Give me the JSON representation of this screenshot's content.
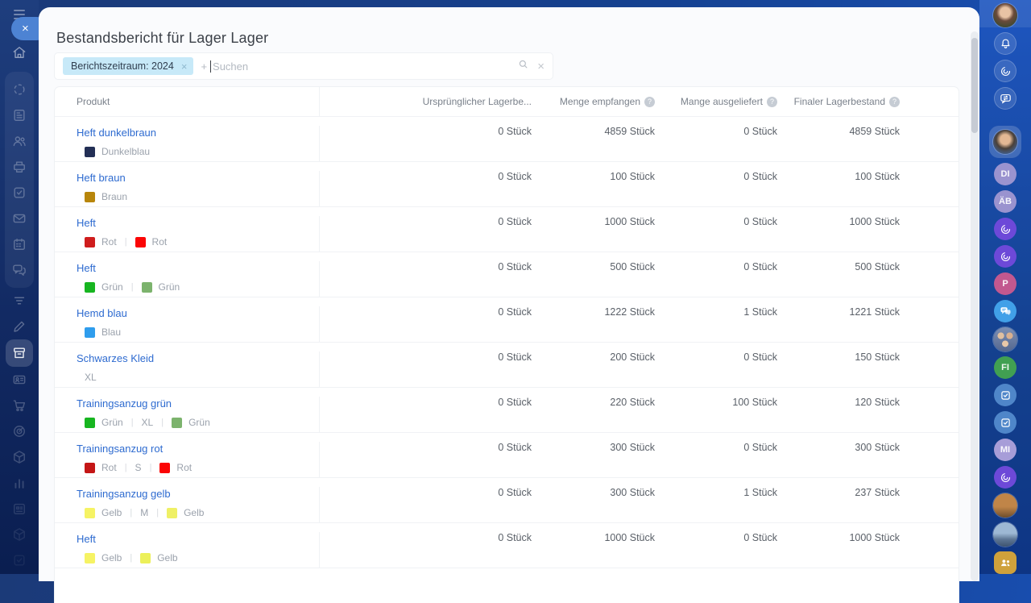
{
  "title": "Bestandsbericht für Lager Lager",
  "filters": {
    "tag_label": "Berichtszeitraum: 2024",
    "remove_glyph": "×",
    "plus_glyph": "+",
    "search_placeholder": "Suchen",
    "clear_glyph": "×"
  },
  "window_controls": {
    "close_glyph": "×"
  },
  "table": {
    "product_header": "Produkt",
    "help_glyph": "?",
    "value_headers": [
      {
        "label": "Ursprünglicher Lagerbe...",
        "help": false
      },
      {
        "label": "Menge empfangen",
        "help": true
      },
      {
        "label": "Mange ausgeliefert",
        "help": true
      },
      {
        "label": "Finaler Lagerbestand",
        "help": true
      }
    ],
    "variant_separator": "|",
    "rows": [
      {
        "product": "Heft dunkelbraun",
        "variants": [
          {
            "swatch": "#232f55",
            "label": "Dunkelblau"
          }
        ],
        "values": [
          "0 Stück",
          "4859 Stück",
          "0 Stück",
          "4859 Stück"
        ]
      },
      {
        "product": "Heft braun",
        "variants": [
          {
            "swatch": "#b8860b",
            "label": "Braun"
          }
        ],
        "values": [
          "0 Stück",
          "100 Stück",
          "0 Stück",
          "100 Stück"
        ]
      },
      {
        "product": "Heft",
        "variants": [
          {
            "swatch": "#cf1d1d",
            "label": "Rot"
          },
          {
            "swatch": "#fb0505",
            "label": "Rot"
          }
        ],
        "values": [
          "0 Stück",
          "1000 Stück",
          "0 Stück",
          "1000 Stück"
        ]
      },
      {
        "product": "Heft",
        "variants": [
          {
            "swatch": "#17b520",
            "label": "Grün"
          },
          {
            "swatch": "#7cb36d",
            "label": "Grün"
          }
        ],
        "values": [
          "0 Stück",
          "500 Stück",
          "0 Stück",
          "500 Stück"
        ]
      },
      {
        "product": "Hemd blau",
        "variants": [
          {
            "swatch": "#2f9ded",
            "label": "Blau"
          }
        ],
        "values": [
          "0 Stück",
          "1222 Stück",
          "1 Stück",
          "1221 Stück"
        ]
      },
      {
        "product": "Schwarzes Kleid",
        "variants": [
          {
            "swatch": null,
            "label": "XL"
          }
        ],
        "values": [
          "0 Stück",
          "200 Stück",
          "0 Stück",
          "150 Stück"
        ]
      },
      {
        "product": "Trainingsanzug grün",
        "variants": [
          {
            "swatch": "#17b520",
            "label": "Grün"
          },
          {
            "swatch": null,
            "label": "XL"
          },
          {
            "swatch": "#7cb36d",
            "label": "Grün"
          }
        ],
        "values": [
          "0 Stück",
          "220 Stück",
          "100 Stück",
          "120 Stück"
        ]
      },
      {
        "product": "Trainingsanzug rot",
        "variants": [
          {
            "swatch": "#c41616",
            "label": "Rot"
          },
          {
            "swatch": null,
            "label": "S"
          },
          {
            "swatch": "#fb0505",
            "label": "Rot"
          }
        ],
        "values": [
          "0 Stück",
          "300 Stück",
          "0 Stück",
          "300 Stück"
        ]
      },
      {
        "product": "Trainingsanzug gelb",
        "variants": [
          {
            "swatch": "#f6f364",
            "label": "Gelb"
          },
          {
            "swatch": null,
            "label": "M"
          },
          {
            "swatch": "#eff065",
            "label": "Gelb"
          }
        ],
        "values": [
          "0 Stück",
          "300 Stück",
          "1 Stück",
          "237 Stück"
        ]
      },
      {
        "product": "Heft",
        "variants": [
          {
            "swatch": "#f6f364",
            "label": "Gelb"
          },
          {
            "swatch": "#ecf05a",
            "label": "Gelb"
          }
        ],
        "values": [
          "0 Stück",
          "1000 Stück",
          "0 Stück",
          "1000 Stück"
        ]
      }
    ]
  },
  "left_rail": {
    "home": {
      "name": "home",
      "icon": "home",
      "opacity": 0.5
    },
    "group_items": [
      {
        "name": "sync",
        "icon": "sync",
        "opacity": 0.28
      },
      {
        "name": "news",
        "icon": "news",
        "opacity": 0.28
      },
      {
        "name": "people",
        "icon": "users",
        "opacity": 0.28
      },
      {
        "name": "print",
        "icon": "printer",
        "opacity": 0.28
      },
      {
        "name": "tasks",
        "icon": "tasks",
        "opacity": 0.28
      },
      {
        "name": "mail",
        "icon": "mail",
        "opacity": 0.28
      },
      {
        "name": "calendar",
        "icon": "calendar",
        "opacity": 0.28
      },
      {
        "name": "chat",
        "icon": "chat",
        "opacity": 0.28
      }
    ],
    "bottom_items": [
      {
        "name": "filter",
        "icon": "filter",
        "opacity": 0.3
      },
      {
        "name": "edit",
        "icon": "pen",
        "opacity": 0.3
      },
      {
        "name": "warehouse",
        "icon": "warehouse",
        "opacity": 0.9,
        "active": true
      },
      {
        "name": "badge",
        "icon": "badge",
        "opacity": 0.26
      },
      {
        "name": "cart",
        "icon": "cart",
        "opacity": 0.24
      },
      {
        "name": "target",
        "icon": "target",
        "opacity": 0.22
      },
      {
        "name": "package",
        "icon": "package",
        "opacity": 0.2
      },
      {
        "name": "stats",
        "icon": "stats",
        "opacity": 0.16
      },
      {
        "name": "planner",
        "icon": "planner",
        "opacity": 0.13
      },
      {
        "name": "package-dim",
        "icon": "package",
        "opacity": 0.09
      },
      {
        "name": "tasks-dim",
        "icon": "tasks",
        "opacity": 0.06
      }
    ]
  },
  "right_rail": {
    "items": [
      {
        "name": "user-avatar",
        "kind": "photo",
        "photo": "woman",
        "wrap": "highlight"
      },
      {
        "name": "notifications-button",
        "kind": "icon",
        "icon": "bell",
        "bg": "glass"
      },
      {
        "name": "brand-button",
        "kind": "icon",
        "icon": "swirl",
        "bg": "glass"
      },
      {
        "name": "conversations-button",
        "kind": "icon",
        "icon": "chat-sync",
        "bg": "glass"
      },
      {
        "name": "rail-divider",
        "kind": "divider"
      },
      {
        "name": "active-user-avatar",
        "kind": "photo",
        "photo": "man",
        "wrap": "active"
      },
      {
        "name": "avatar-DI",
        "kind": "initials",
        "label": "DI",
        "bg": "#9a93cf"
      },
      {
        "name": "avatar-AB",
        "kind": "initials",
        "label": "ÄB",
        "bg": "#9a93cf"
      },
      {
        "name": "workspace-logo-1",
        "kind": "icon",
        "icon": "swirl",
        "bg": "#6d49d8"
      },
      {
        "name": "workspace-logo-2",
        "kind": "icon",
        "icon": "swirl",
        "bg": "#6d49d8"
      },
      {
        "name": "avatar-P",
        "kind": "initials",
        "label": "P",
        "bg": "#c2588f"
      },
      {
        "name": "chat-space",
        "kind": "icon",
        "icon": "chat-bubbles",
        "bg": "#41a0e8"
      },
      {
        "name": "team-avatar",
        "kind": "photo",
        "photo": "group"
      },
      {
        "name": "avatar-FI",
        "kind": "initials",
        "label": "FI",
        "bg": "#41a052"
      },
      {
        "name": "tasks-space-1",
        "kind": "icon",
        "icon": "check-square",
        "bg": "#4f86c9"
      },
      {
        "name": "tasks-space-2",
        "kind": "icon",
        "icon": "check-square",
        "bg": "#4f86c9"
      },
      {
        "name": "avatar-MI",
        "kind": "initials",
        "label": "MI",
        "bg": "#a79dd8"
      },
      {
        "name": "workspace-logo-3",
        "kind": "icon",
        "icon": "swirl",
        "bg": "#6d49d8"
      },
      {
        "name": "photo-space-1",
        "kind": "photo",
        "photo": "building"
      },
      {
        "name": "photo-space-2",
        "kind": "photo",
        "photo": "landscape"
      },
      {
        "name": "people-space",
        "kind": "icon",
        "icon": "users-fill",
        "bg": "#cfa13b",
        "shape": "square"
      }
    ]
  }
}
